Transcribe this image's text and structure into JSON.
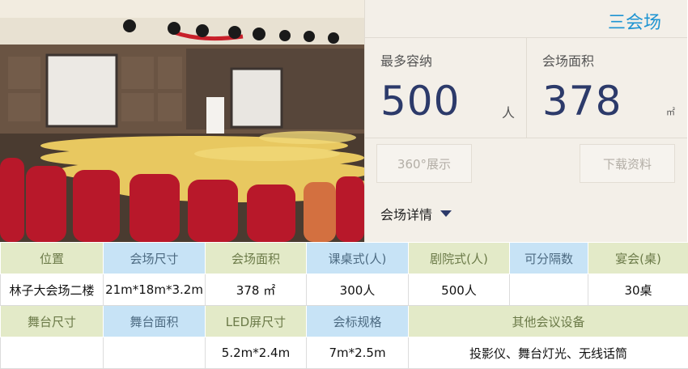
{
  "venue": {
    "name": "三会场",
    "capacity_label": "最多容纳",
    "capacity_value": "500",
    "capacity_unit": "人",
    "area_label": "会场面积",
    "area_value": "378",
    "area_unit": "㎡",
    "btn_360": "360°展示",
    "btn_download": "下载资料",
    "details_label": "会场详情"
  },
  "table": {
    "row1_headers": [
      "位置",
      "会场尺寸",
      "会场面积",
      "课桌式(人)",
      "剧院式(人)",
      "可分隔数",
      "宴会(桌)"
    ],
    "row1_values": [
      "林子大会场二楼",
      "21m*18m*3.2m",
      "378 ㎡",
      "300人",
      "500人",
      "",
      "30桌"
    ],
    "row2_headers": [
      "舞台尺寸",
      "舞台面积",
      "LED屏尺寸",
      "会标规格",
      "其他会议设备"
    ],
    "row2_values": [
      "",
      "",
      "5.2m*2.4m",
      "7m*2.5m",
      "投影仪、舞台灯光、无线话筒"
    ]
  },
  "colors": {
    "accent_blue": "#1e94d2",
    "number_navy": "#2c3a6a",
    "header_green": "#e3eac8",
    "header_blue": "#c7e3f6"
  }
}
